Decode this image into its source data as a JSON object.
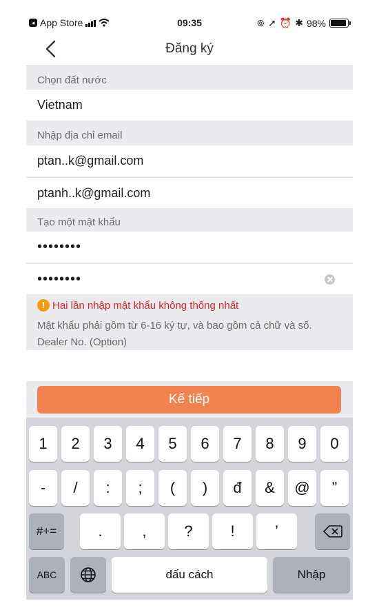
{
  "status_bar": {
    "back_app": "App Store",
    "time": "09:35",
    "battery": "98%",
    "battery_level": 0.98
  },
  "nav": {
    "title": "Đăng ký"
  },
  "form": {
    "country_label": "Chọn đất nước",
    "country_value": "Vietnam",
    "email_label": "Nhập địa chỉ email",
    "email_value": "ptan..k@gmail.com",
    "email_confirm_value": "ptanh..k@gmail.com",
    "password_label": "Tạo một mật khẩu",
    "password_value": "••••••••",
    "password_confirm_value": "••••••••",
    "error_text": "Hai lần nhập mật khẩu không thống nhất",
    "hint_text": "Mật khẩu phải gồm từ 6-16 ký tự, và bao gồm cả chữ và số.",
    "dealer_label": "Dealer No. (Option)",
    "dealer_value": ""
  },
  "next_button": "Kế tiếp",
  "accent_color": "#f2834f",
  "error_color": "#d6281c",
  "keyboard": {
    "row1": [
      "1",
      "2",
      "3",
      "4",
      "5",
      "6",
      "7",
      "8",
      "9",
      "0"
    ],
    "row2": [
      "-",
      "/",
      ":",
      ";",
      "(",
      ")",
      "đ",
      "&",
      "@",
      "”"
    ],
    "row3": [
      ".",
      ",",
      "?",
      "!",
      "’"
    ],
    "symbols_key": "#+=",
    "abc_key": "ABC",
    "space_key": "dấu cách",
    "return_key": "Nhập"
  }
}
